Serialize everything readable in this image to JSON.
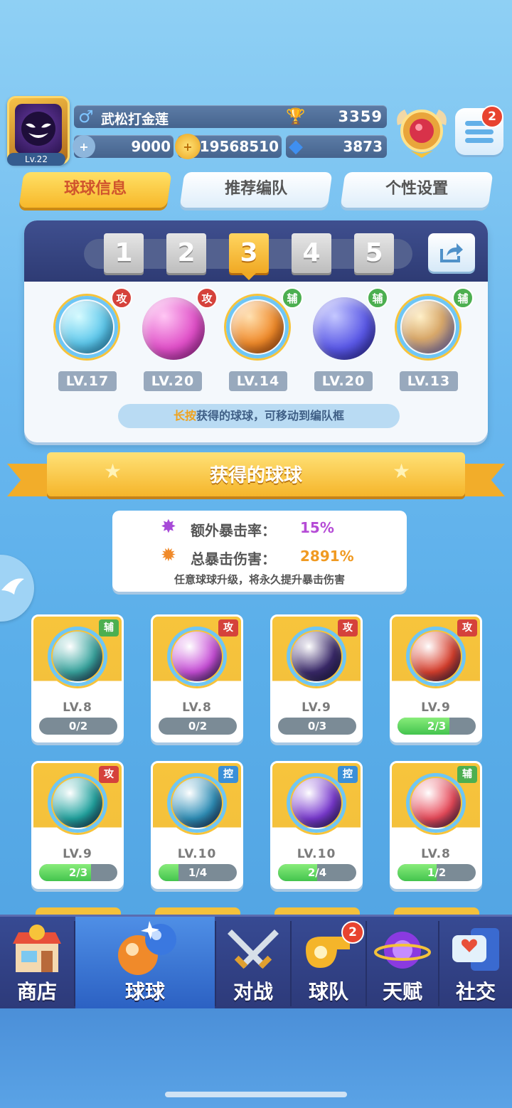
{
  "profile": {
    "name": "武松打金莲",
    "gender_symbol": "♂",
    "level": "Lv.22",
    "trophies": "3359",
    "energy": "9000",
    "coins": "19568510",
    "gems": "3873",
    "menu_badge": "2"
  },
  "tabs": [
    {
      "label": "球球信息",
      "active": true
    },
    {
      "label": "推荐编队",
      "active": false
    },
    {
      "label": "个性设置",
      "active": false
    }
  ],
  "team": {
    "slots": [
      "1",
      "2",
      "3",
      "4",
      "5"
    ],
    "active_slot": "3",
    "balls": [
      {
        "role": "攻",
        "level": "LV.17",
        "color": "#5ec8ec"
      },
      {
        "role": "攻",
        "level": "LV.20",
        "color": "#e050c8"
      },
      {
        "role": "辅",
        "level": "LV.14",
        "color": "#f08a2a"
      },
      {
        "role": "辅",
        "level": "LV.20",
        "color": "#5a58e6"
      },
      {
        "role": "辅",
        "level": "LV.13",
        "color": "#d8a86a"
      }
    ],
    "hint_highlight": "长按",
    "hint_text": "获得的球球，可移动到编队框"
  },
  "section_title": "获得的球球",
  "crit": {
    "extra_rate_label": "额外暴击率：",
    "extra_rate_value": "15%",
    "total_damage_label": "总暴击伤害：",
    "total_damage_value": "2891%",
    "note": "任意球球升级，将永久提升暴击伤害"
  },
  "cards": [
    {
      "role": "辅",
      "level": "LV.8",
      "progress": "0/2",
      "fill": 0,
      "color": "#3aa6a0"
    },
    {
      "role": "攻",
      "level": "LV.8",
      "progress": "0/2",
      "fill": 0,
      "color": "#c84fd8"
    },
    {
      "role": "攻",
      "level": "LV.9",
      "progress": "0/3",
      "fill": 0,
      "color": "#3b2a6b"
    },
    {
      "role": "攻",
      "level": "LV.9",
      "progress": "2/3",
      "fill": 0.667,
      "color": "#d8402e"
    },
    {
      "role": "攻",
      "level": "LV.9",
      "progress": "2/3",
      "fill": 0.667,
      "color": "#22a4a0"
    },
    {
      "role": "控",
      "level": "LV.10",
      "progress": "1/4",
      "fill": 0.25,
      "color": "#2f8fb8"
    },
    {
      "role": "控",
      "level": "LV.10",
      "progress": "2/4",
      "fill": 0.5,
      "color": "#7a3ad0"
    },
    {
      "role": "辅",
      "level": "LV.8",
      "progress": "1/2",
      "fill": 0.5,
      "color": "#e84a5a"
    }
  ],
  "nav": [
    {
      "label": "商店",
      "active": false,
      "badge": ""
    },
    {
      "label": "球球",
      "active": true,
      "badge": ""
    },
    {
      "label": "对战",
      "active": false,
      "badge": ""
    },
    {
      "label": "球队",
      "active": false,
      "badge": "2"
    },
    {
      "label": "天赋",
      "active": false,
      "badge": ""
    },
    {
      "label": "社交",
      "active": false,
      "badge": ""
    }
  ]
}
